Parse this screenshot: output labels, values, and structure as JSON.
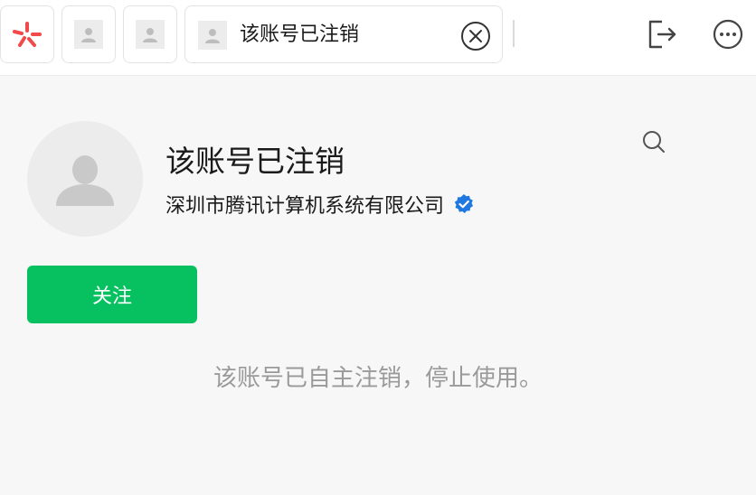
{
  "tabs": {
    "app_icon": "pinwheel-logo-icon",
    "active_title": "该账号已注销"
  },
  "account": {
    "name": "该账号已注销",
    "org": "深圳市腾讯计算机系统有限公司",
    "verified": true
  },
  "buttons": {
    "follow_label": "关注"
  },
  "notice": "该账号已自主注销，停止使用。",
  "colors": {
    "accent": "#07c160",
    "verified": "#1f78e0",
    "logo": "#f24a4a",
    "muted_text": "#9a9a9a"
  }
}
